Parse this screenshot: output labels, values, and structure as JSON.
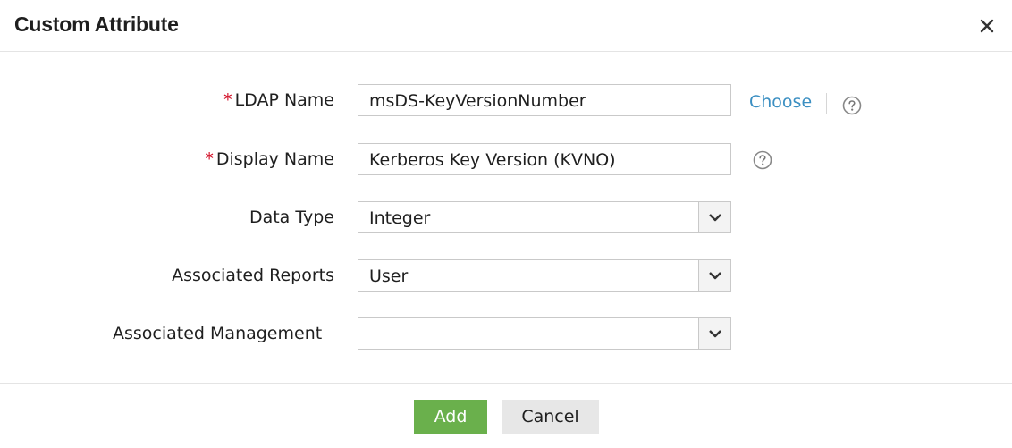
{
  "dialog": {
    "title": "Custom Attribute"
  },
  "form": {
    "ldap_name": {
      "label": "LDAP Name",
      "required_mark": "*",
      "value": "msDS-KeyVersionNumber",
      "choose_label": "Choose"
    },
    "display_name": {
      "label": "Display Name",
      "required_mark": "*",
      "value": "Kerberos Key Version (KVNO)"
    },
    "data_type": {
      "label": "Data Type",
      "value": "Integer"
    },
    "associated_reports": {
      "label": "Associated Reports",
      "value": "User"
    },
    "associated_management": {
      "label": "Associated Management",
      "value": ""
    }
  },
  "buttons": {
    "add": "Add",
    "cancel": "Cancel"
  },
  "colors": {
    "required": "#d0021b",
    "link": "#3b8fc2",
    "primary_button": "#6ab04c",
    "secondary_button": "#e7e7e7"
  },
  "icons": {
    "close": "close-icon",
    "help": "question-circle-icon",
    "dropdown": "chevron-down-icon"
  }
}
